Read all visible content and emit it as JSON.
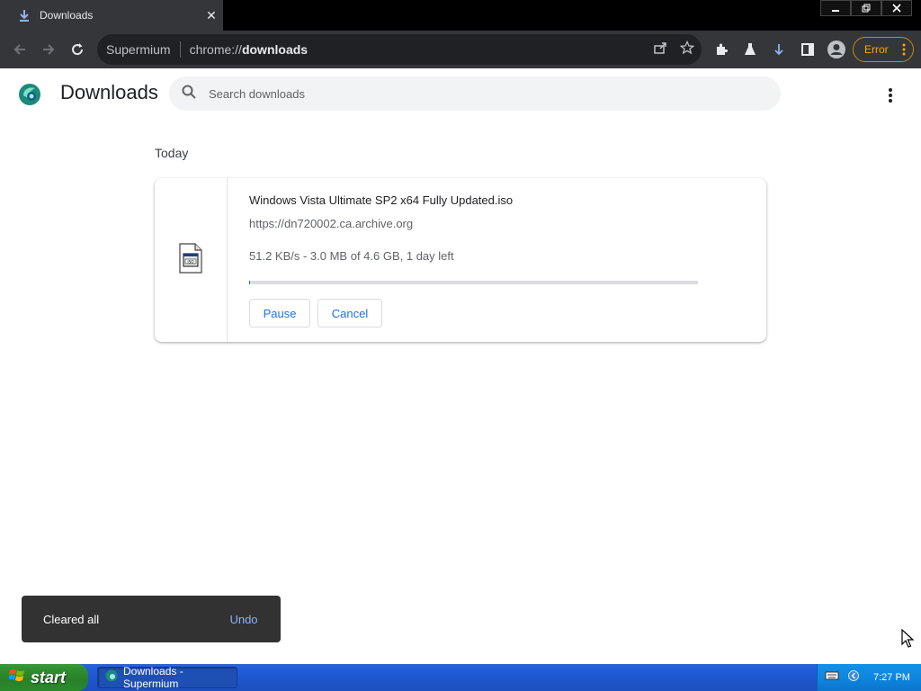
{
  "browser": {
    "tab": {
      "title": "Downloads",
      "icon": "download-arrow-icon"
    },
    "omnibox": {
      "site_label": "Supermium",
      "url_prefix": "chrome://",
      "url_path": "downloads"
    },
    "error_chip": {
      "label": "Error"
    }
  },
  "page": {
    "title": "Downloads",
    "search": {
      "placeholder": "Search downloads"
    }
  },
  "downloads": {
    "section_date": "Today",
    "items": [
      {
        "file_name": "Windows Vista Ultimate SP2 x64 Fully Updated.iso",
        "url": "https://dn720002.ca.archive.org",
        "status": "51.2 KB/s - 3.0 MB of 4.6 GB, 1 day left",
        "progress_fraction": 0.0007,
        "pause_label": "Pause",
        "cancel_label": "Cancel"
      }
    ]
  },
  "toast": {
    "message": "Cleared all",
    "action": "Undo"
  },
  "taskbar": {
    "start_label": "start",
    "task_label": "Downloads - Supermium",
    "clock": "7:27 PM"
  },
  "colors": {
    "accent": "#1a73e8",
    "error": "#f9ab00",
    "toast_bg": "#323232",
    "xp_blue": "#245edb"
  }
}
